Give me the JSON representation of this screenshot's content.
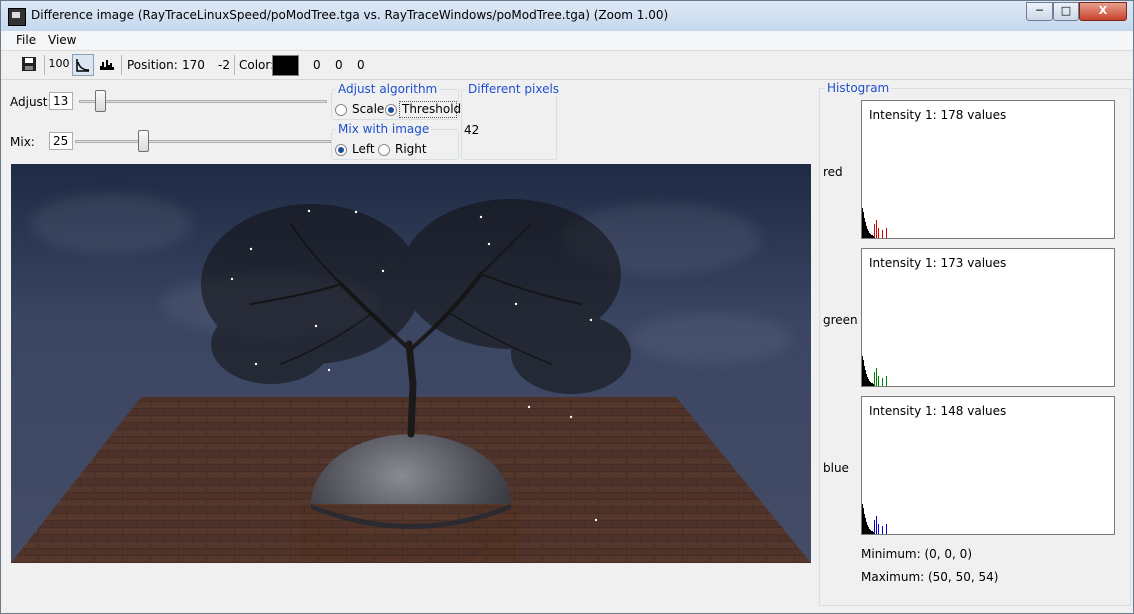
{
  "window": {
    "title": "Difference image (RayTraceLinuxSpeed/poModTree.tga vs. RayTraceWindows/poModTree.tga) (Zoom 1.00)",
    "controls": {
      "minimize": "─",
      "maximize": "□",
      "close": "X"
    }
  },
  "menu": {
    "file": "File",
    "view": "View"
  },
  "toolbar": {
    "save_icon": "save-icon",
    "zoom_label": "100",
    "position_label": "Position:",
    "position_x": "170",
    "position_y": "-2",
    "color_label": "Color:",
    "color_value": "#000000",
    "color_r": "0",
    "color_g": "0",
    "color_b": "0"
  },
  "adjust": {
    "label": "Adjust:",
    "value": "13",
    "slider_fraction": 0.06
  },
  "mix": {
    "label": "Mix:",
    "value": "25",
    "slider_fraction": 0.25
  },
  "adjust_algorithm": {
    "title": "Adjust algorithm",
    "scale": "Scale",
    "threshold": "Threshold",
    "selected": "threshold"
  },
  "mix_with_image": {
    "title": "Mix with image",
    "left": "Left",
    "right": "Right",
    "selected": "left"
  },
  "different_pixels": {
    "title": "Different pixels",
    "value": "42"
  },
  "histogram": {
    "title": "Histogram",
    "channels": [
      {
        "name": "red",
        "info": "Intensity   1: 178 values",
        "color": "#d00000"
      },
      {
        "name": "green",
        "info": "Intensity   1: 173 values",
        "color": "#008000"
      },
      {
        "name": "blue",
        "info": "Intensity   1: 148 values",
        "color": "#0000d0"
      }
    ],
    "minimum": "Minimum: (0, 0, 0)",
    "maximum": "Maximum: (50, 50, 54)"
  }
}
